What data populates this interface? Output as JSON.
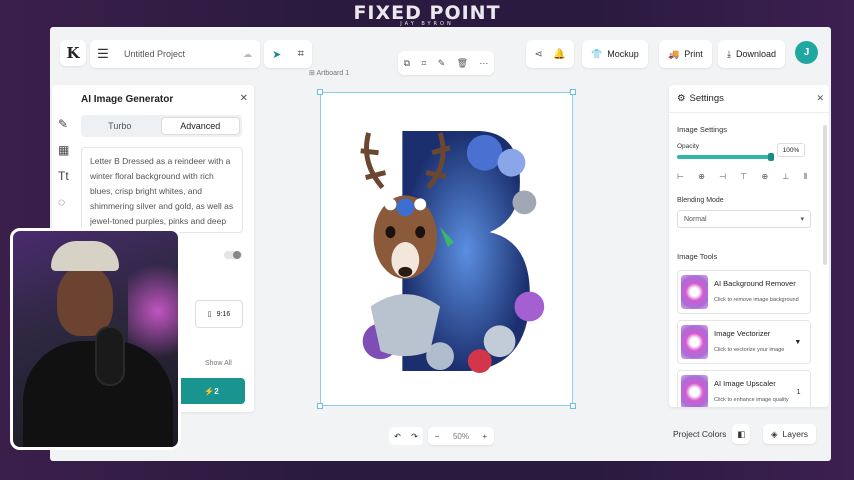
{
  "brand": {
    "title": "FIXED POINT",
    "subtitle": "JAY BYRON"
  },
  "header": {
    "logo": "K",
    "project_name": "Untitled Project",
    "share_icon": "share-icon",
    "mockup_label": "Mockup",
    "print_label": "Print",
    "download_label": "Download",
    "avatar_initial": "J"
  },
  "canvas": {
    "artboard_label": "Artboard 1"
  },
  "zoom": {
    "value": "50%",
    "minus": "−",
    "plus": "+"
  },
  "left_panel": {
    "title": "AI Image Generator",
    "tabs": [
      {
        "label": "Turbo",
        "active": false
      },
      {
        "label": "Advanced",
        "active": true
      }
    ],
    "prompt": "Letter B Dressed as a reindeer with a winter floral background with rich blues, crisp bright whites, and shimmering silver and gold, as well as jewel-toned purples, pinks and deep",
    "ratio_label": "9:16",
    "show_all": "Show All",
    "generate_label": "2"
  },
  "right_panel": {
    "title": "Settings",
    "image_settings": "Image Settings",
    "opacity_label": "Opacity",
    "opacity_value": "100%",
    "opacity": 1.0,
    "blending_label": "Blending Mode",
    "blending_value": "Normal",
    "image_tools": "Image Tools",
    "tools": [
      {
        "name": "AI Background Remover",
        "desc": "Click to remove image background"
      },
      {
        "name": "Image Vectorizer",
        "desc": "Click to vectorize your image"
      },
      {
        "name": "AI Image Upscaler",
        "desc": "Click to enhance image quality",
        "badge": "1"
      }
    ]
  },
  "footer": {
    "project_colors": "Project Colors",
    "layers": "Layers"
  },
  "colors": {
    "accent": "#1a948f",
    "selection": "#6bbfe0"
  }
}
